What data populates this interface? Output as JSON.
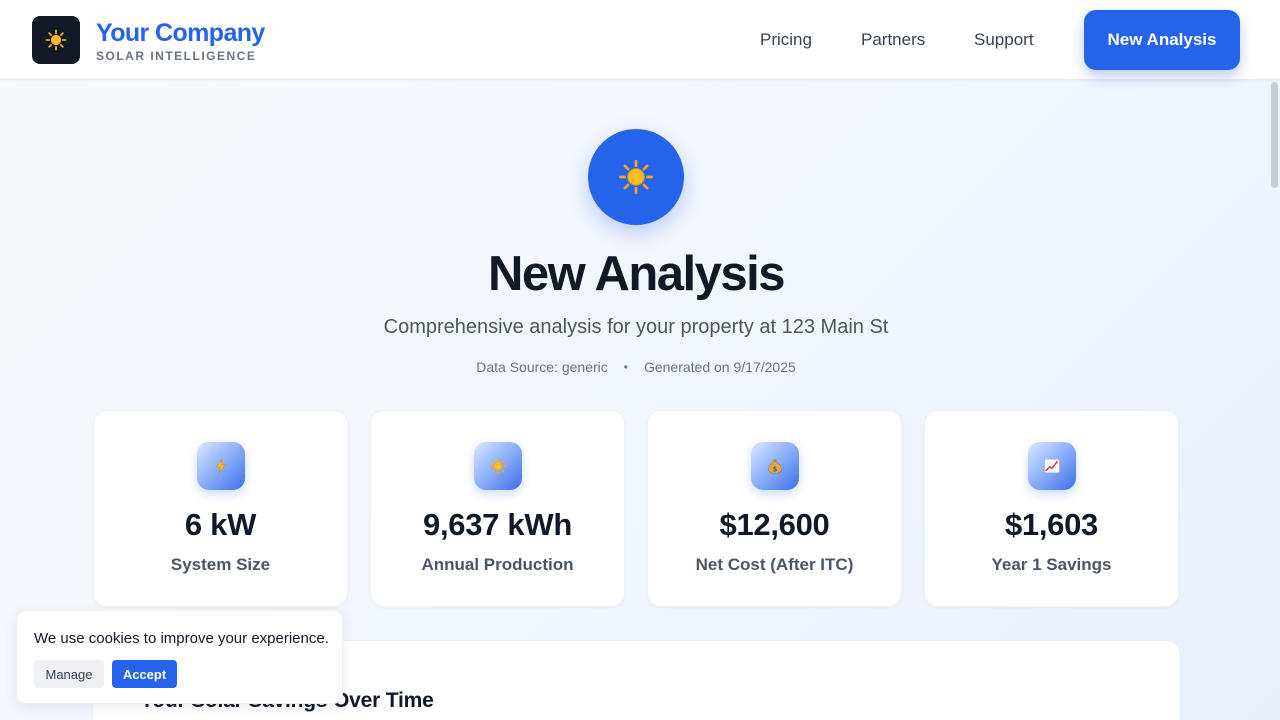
{
  "header": {
    "logo_icon": "sun-icon",
    "brand_name": "Your Company",
    "brand_tagline": "SOLAR INTELLIGENCE",
    "nav": [
      {
        "label": "Pricing"
      },
      {
        "label": "Partners"
      },
      {
        "label": "Support"
      }
    ],
    "cta_label": "New Analysis"
  },
  "hero": {
    "icon": "sun-icon",
    "title": "New Analysis",
    "subtitle": "Comprehensive analysis for your property at 123 Main St",
    "data_source": "Data Source: generic",
    "separator": "•",
    "generated": "Generated on 9/17/2025"
  },
  "stats": [
    {
      "icon": "lightning-icon",
      "value": "6 kW",
      "label": "System Size"
    },
    {
      "icon": "sun-icon",
      "value": "9,637 kWh",
      "label": "Annual Production"
    },
    {
      "icon": "money-bag-icon",
      "value": "$12,600",
      "label": "Net Cost (After ITC)"
    },
    {
      "icon": "chart-increasing-icon",
      "value": "$1,603",
      "label": "Year 1 Savings"
    }
  ],
  "savings_panel": {
    "title": "Your Solar Savings Over Time"
  },
  "cookie_banner": {
    "message": "We use cookies to improve your experience.",
    "manage_label": "Manage",
    "accept_label": "Accept"
  },
  "colors": {
    "brand": "#2563eb",
    "text_dark": "#111827",
    "text_muted": "#4b5563",
    "logo_bg": "#111827"
  }
}
